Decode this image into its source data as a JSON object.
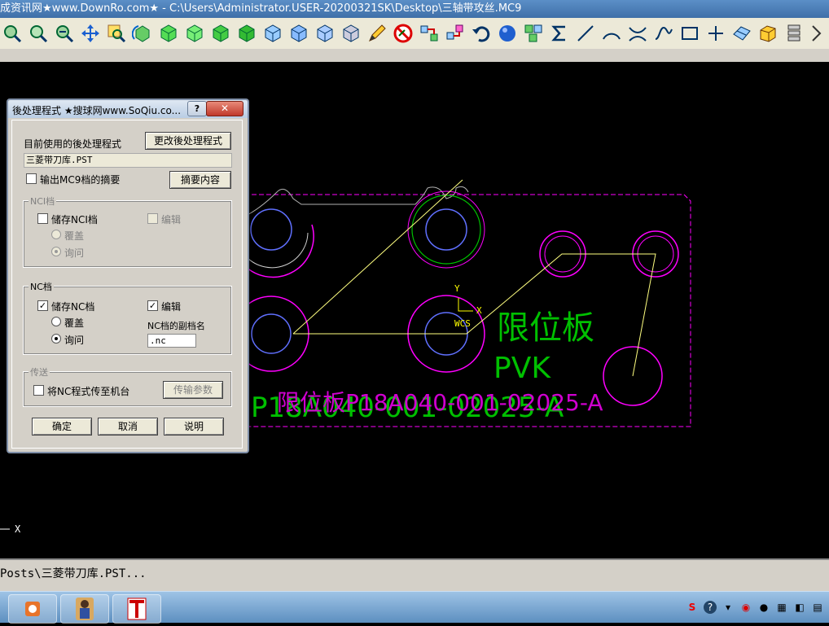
{
  "window": {
    "title": "成资讯网★www.DownRo.com★ - C:\\Users\\Administrator.USER-20200321SK\\Desktop\\三轴带攻丝.MC9"
  },
  "toolbar": {
    "icons": [
      "zoom-window-icon",
      "zoom-icon",
      "unzoom-icon",
      "pan-icon",
      "zoom-select-icon",
      "rotate-icon",
      "view-top-icon",
      "view-front-icon",
      "view-side-icon",
      "view-iso-icon",
      "cube-1-icon",
      "cube-2-icon",
      "cube-3-icon",
      "cube-4-icon",
      "edit-pencil-icon",
      "no-entry-icon",
      "move-icon",
      "transform-icon",
      "undo-icon",
      "sphere-icon",
      "group-icon",
      "sigma-icon",
      "line-icon",
      "arc-icon",
      "trim-icon",
      "spline-icon",
      "rectangle-icon",
      "point-icon",
      "surface-icon",
      "solid-icon",
      "stack-icon",
      "more-icon"
    ]
  },
  "canvas": {
    "label_cn": "限位板",
    "label_pvk": "PVK",
    "part_text_1": "限位板P18A040-001-02025-A",
    "part_text_2": "P18A040-001-02025-A",
    "axis_y": "Y",
    "axis_x": "X",
    "axis_wcs": "WCS",
    "corner_axis": "X",
    "colors": {
      "outline": "#ff00ff",
      "green": "#00c000",
      "yellow": "#ffff80",
      "blue": "#6080ff"
    }
  },
  "dialog": {
    "title": "後处理程式  ★搜球网www.SoQiu.co...",
    "help_label": "?",
    "close_label": "✕",
    "current_post_label": "目前使用的後处理程式",
    "change_post_button": "更改後处理程式",
    "post_file": "三菱带刀库.PST",
    "output_summary_label": "输出MC9档的摘要",
    "summary_button": "摘要内容",
    "nci_group": "NCI档",
    "save_nci": "储存NCI档",
    "edit_nci": "编辑",
    "overwrite_nci": "覆盖",
    "ask_nci": "询问",
    "nc_group": "NC档",
    "save_nc": "储存NC档",
    "edit_nc": "编辑",
    "overwrite_nc": "覆盖",
    "ask_nc": "询问",
    "nc_ext_label": "NC档的副档名",
    "nc_ext_value": ".nc",
    "send_group": "传送",
    "send_to_machine": "将NC程式传至机台",
    "transfer_params_button": "传输参数",
    "ok_button": "确定",
    "cancel_button": "取消",
    "help_button": "说明",
    "states": {
      "output_summary": false,
      "save_nci": false,
      "edit_nci": false,
      "nci_mode": "ask",
      "save_nc": true,
      "edit_nc": true,
      "nc_mode": "ask",
      "send_to_machine": false
    }
  },
  "statusbar": {
    "text": "Posts\\三菱带刀库.PST..."
  }
}
